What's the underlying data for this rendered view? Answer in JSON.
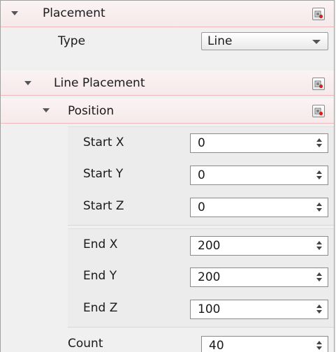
{
  "placement": {
    "title": "Placement",
    "icon": "properties-icon"
  },
  "type_row": {
    "label": "Type",
    "value": "Line"
  },
  "line_placement": {
    "title": "Line Placement",
    "icon": "properties-icon"
  },
  "position": {
    "title": "Position",
    "icon": "properties-icon"
  },
  "fields": [
    {
      "label": "Start X",
      "value": "0"
    },
    {
      "label": "Start Y",
      "value": "0"
    },
    {
      "label": "Start Z",
      "value": "0"
    },
    {
      "label": "End X",
      "value": "200"
    },
    {
      "label": "End Y",
      "value": "200"
    },
    {
      "label": "End Z",
      "value": "100"
    }
  ],
  "count": {
    "label": "Count",
    "value": "40"
  }
}
